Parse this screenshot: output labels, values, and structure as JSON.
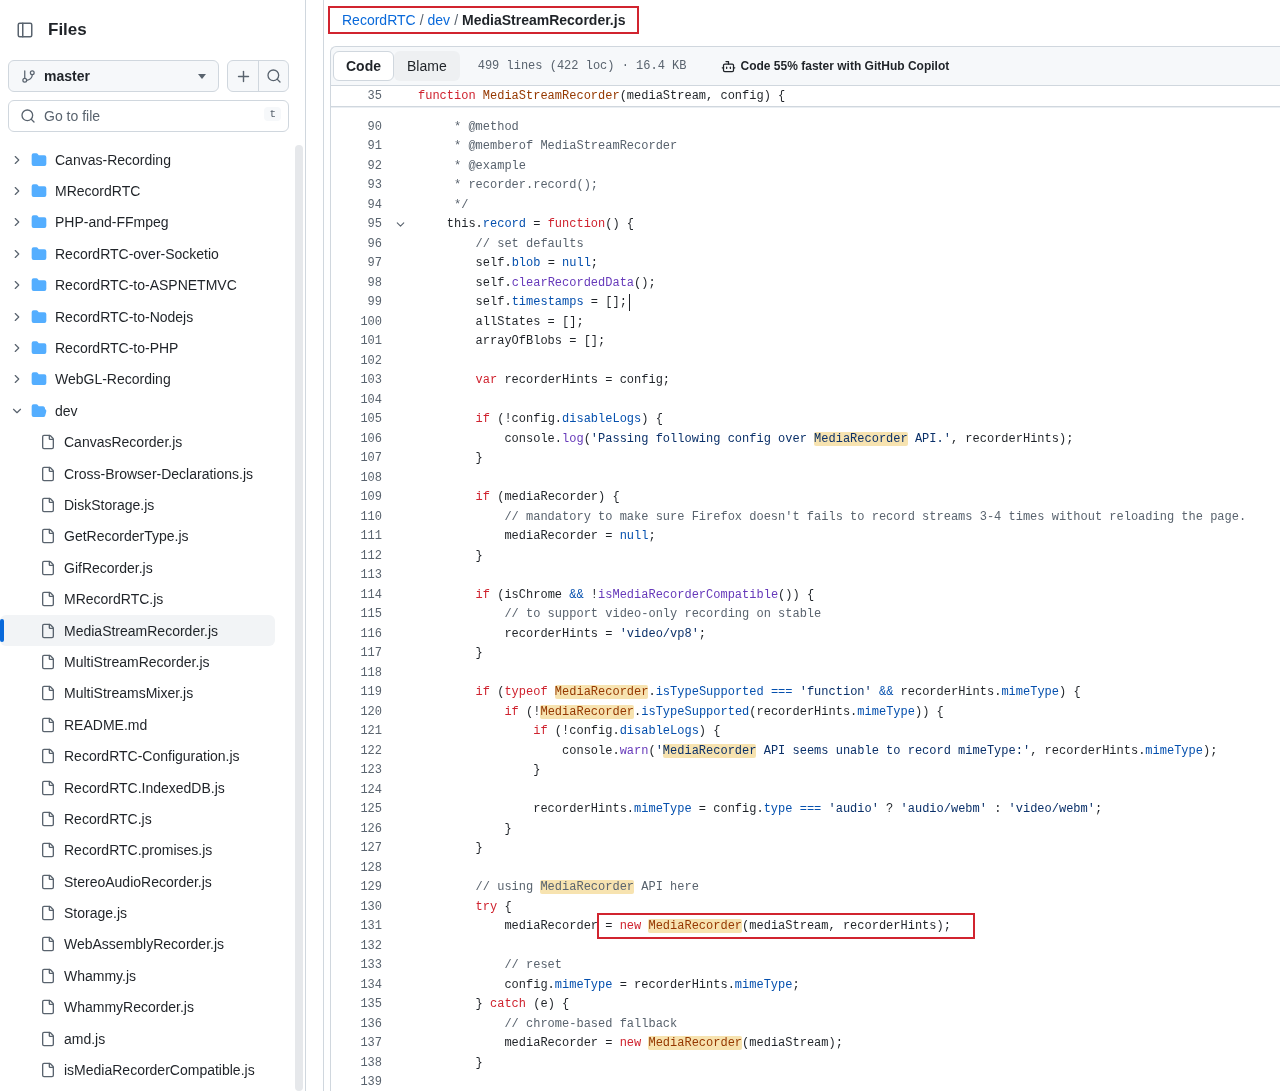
{
  "sidebar": {
    "title": "Files",
    "branch": "master",
    "search": {
      "placeholder": "Go to file",
      "shortcut": "t"
    },
    "tree": [
      {
        "kind": "folder",
        "name": "Canvas-Recording",
        "expanded": false,
        "selected": false
      },
      {
        "kind": "folder",
        "name": "MRecordRTC",
        "expanded": false,
        "selected": false
      },
      {
        "kind": "folder",
        "name": "PHP-and-FFmpeg",
        "expanded": false,
        "selected": false
      },
      {
        "kind": "folder",
        "name": "RecordRTC-over-Socketio",
        "expanded": false,
        "selected": false
      },
      {
        "kind": "folder",
        "name": "RecordRTC-to-ASPNETMVC",
        "expanded": false,
        "selected": false
      },
      {
        "kind": "folder",
        "name": "RecordRTC-to-Nodejs",
        "expanded": false,
        "selected": false
      },
      {
        "kind": "folder",
        "name": "RecordRTC-to-PHP",
        "expanded": false,
        "selected": false
      },
      {
        "kind": "folder",
        "name": "WebGL-Recording",
        "expanded": false,
        "selected": false
      },
      {
        "kind": "folder",
        "name": "dev",
        "expanded": true,
        "selected": false,
        "children": [
          {
            "kind": "file",
            "name": "CanvasRecorder.js",
            "selected": false
          },
          {
            "kind": "file",
            "name": "Cross-Browser-Declarations.js",
            "selected": false
          },
          {
            "kind": "file",
            "name": "DiskStorage.js",
            "selected": false
          },
          {
            "kind": "file",
            "name": "GetRecorderType.js",
            "selected": false
          },
          {
            "kind": "file",
            "name": "GifRecorder.js",
            "selected": false
          },
          {
            "kind": "file",
            "name": "MRecordRTC.js",
            "selected": false
          },
          {
            "kind": "file",
            "name": "MediaStreamRecorder.js",
            "selected": true
          },
          {
            "kind": "file",
            "name": "MultiStreamRecorder.js",
            "selected": false
          },
          {
            "kind": "file",
            "name": "MultiStreamsMixer.js",
            "selected": false
          },
          {
            "kind": "file",
            "name": "README.md",
            "selected": false
          },
          {
            "kind": "file",
            "name": "RecordRTC-Configuration.js",
            "selected": false
          },
          {
            "kind": "file",
            "name": "RecordRTC.IndexedDB.js",
            "selected": false
          },
          {
            "kind": "file",
            "name": "RecordRTC.js",
            "selected": false
          },
          {
            "kind": "file",
            "name": "RecordRTC.promises.js",
            "selected": false
          },
          {
            "kind": "file",
            "name": "StereoAudioRecorder.js",
            "selected": false
          },
          {
            "kind": "file",
            "name": "Storage.js",
            "selected": false
          },
          {
            "kind": "file",
            "name": "WebAssemblyRecorder.js",
            "selected": false
          },
          {
            "kind": "file",
            "name": "Whammy.js",
            "selected": false
          },
          {
            "kind": "file",
            "name": "WhammyRecorder.js",
            "selected": false
          },
          {
            "kind": "file",
            "name": "amd.js",
            "selected": false
          },
          {
            "kind": "file",
            "name": "isMediaRecorderCompatible.js",
            "selected": false
          }
        ]
      }
    ]
  },
  "breadcrumb": {
    "annotated": true,
    "parts": [
      {
        "kind": "link",
        "text": "RecordRTC"
      },
      {
        "kind": "separator",
        "text": "/"
      },
      {
        "kind": "link",
        "text": "dev"
      },
      {
        "kind": "separator",
        "text": "/"
      },
      {
        "kind": "current",
        "text": "MediaStreamRecorder.js"
      }
    ]
  },
  "toolbar": {
    "tabs": [
      {
        "label": "Code",
        "selected": true
      },
      {
        "label": "Blame",
        "selected": false
      }
    ],
    "info": "499 lines (422 loc) · 16.4 KB",
    "copilot": "Code 55% faster with GitHub Copilot"
  },
  "code": {
    "sticky": {
      "n": "35",
      "t": [
        {
          "kind": "keyword",
          "s": "function "
        },
        {
          "kind": "entity",
          "s": "MediaStreamRecorder"
        },
        {
          "kind": "plain",
          "s": "(mediaStream, config) {"
        }
      ]
    },
    "lines": [
      {
        "n": "90",
        "t": [
          {
            "kind": "comment",
            "s": "     * @method"
          }
        ]
      },
      {
        "n": "91",
        "t": [
          {
            "kind": "comment",
            "s": "     * @memberof MediaStreamRecorder"
          }
        ]
      },
      {
        "n": "92",
        "t": [
          {
            "kind": "comment",
            "s": "     * @example"
          }
        ]
      },
      {
        "n": "93",
        "t": [
          {
            "kind": "comment",
            "s": "     * recorder.record();"
          }
        ]
      },
      {
        "n": "94",
        "t": [
          {
            "kind": "comment",
            "s": "     */"
          }
        ]
      },
      {
        "n": "95",
        "foldable": true,
        "t": [
          {
            "kind": "plain",
            "s": "    this."
          },
          {
            "kind": "property",
            "s": "record"
          },
          {
            "kind": "plain",
            "s": " = "
          },
          {
            "kind": "keyword",
            "s": "function"
          },
          {
            "kind": "plain",
            "s": "() {"
          }
        ]
      },
      {
        "n": "96",
        "t": [
          {
            "kind": "comment",
            "s": "        // set defaults"
          }
        ]
      },
      {
        "n": "97",
        "t": [
          {
            "kind": "plain",
            "s": "        self."
          },
          {
            "kind": "property",
            "s": "blob"
          },
          {
            "kind": "plain",
            "s": " = "
          },
          {
            "kind": "property",
            "s": "null"
          },
          {
            "kind": "plain",
            "s": ";"
          }
        ]
      },
      {
        "n": "98",
        "t": [
          {
            "kind": "plain",
            "s": "        self."
          },
          {
            "kind": "method",
            "s": "clearRecordedData"
          },
          {
            "kind": "plain",
            "s": "();"
          }
        ]
      },
      {
        "n": "99",
        "cursor": true,
        "t": [
          {
            "kind": "plain",
            "s": "        self."
          },
          {
            "kind": "property",
            "s": "timestamps"
          },
          {
            "kind": "plain",
            "s": " = [];"
          }
        ]
      },
      {
        "n": "100",
        "t": [
          {
            "kind": "plain",
            "s": "        allStates = [];"
          }
        ]
      },
      {
        "n": "101",
        "t": [
          {
            "kind": "plain",
            "s": "        arrayOfBlobs = [];"
          }
        ]
      },
      {
        "n": "102"
      },
      {
        "n": "103",
        "t": [
          {
            "kind": "keyword",
            "s": "        var"
          },
          {
            "kind": "plain",
            "s": " recorderHints = config;"
          }
        ]
      },
      {
        "n": "104"
      },
      {
        "n": "105",
        "t": [
          {
            "kind": "keyword",
            "s": "        if"
          },
          {
            "kind": "plain",
            "s": " (!config."
          },
          {
            "kind": "property",
            "s": "disableLogs"
          },
          {
            "kind": "plain",
            "s": ") {"
          }
        ]
      },
      {
        "n": "106",
        "t": [
          {
            "kind": "plain",
            "s": "            console."
          },
          {
            "kind": "method",
            "s": "log"
          },
          {
            "kind": "plain",
            "s": "("
          },
          {
            "kind": "string",
            "s": "'Passing following config over "
          },
          {
            "kind": "string",
            "s": "MediaRecorder",
            "hl": true
          },
          {
            "kind": "string",
            "s": " API.'"
          },
          {
            "kind": "plain",
            "s": ", recorderHints);"
          }
        ]
      },
      {
        "n": "107",
        "t": [
          {
            "kind": "plain",
            "s": "        }"
          }
        ]
      },
      {
        "n": "108"
      },
      {
        "n": "109",
        "t": [
          {
            "kind": "keyword",
            "s": "        if"
          },
          {
            "kind": "plain",
            "s": " (mediaRecorder) {"
          }
        ]
      },
      {
        "n": "110",
        "t": [
          {
            "kind": "comment",
            "s": "            // mandatory to make sure Firefox doesn't fails to record streams 3-4 times without reloading the page."
          }
        ]
      },
      {
        "n": "111",
        "t": [
          {
            "kind": "plain",
            "s": "            mediaRecorder = "
          },
          {
            "kind": "property",
            "s": "null"
          },
          {
            "kind": "plain",
            "s": ";"
          }
        ]
      },
      {
        "n": "112",
        "t": [
          {
            "kind": "plain",
            "s": "        }"
          }
        ]
      },
      {
        "n": "113"
      },
      {
        "n": "114",
        "t": [
          {
            "kind": "keyword",
            "s": "        if"
          },
          {
            "kind": "plain",
            "s": " (isChrome "
          },
          {
            "kind": "property",
            "s": "&&"
          },
          {
            "kind": "plain",
            "s": " !"
          },
          {
            "kind": "method",
            "s": "isMediaRecorderCompatible"
          },
          {
            "kind": "plain",
            "s": "()) {"
          }
        ]
      },
      {
        "n": "115",
        "t": [
          {
            "kind": "comment",
            "s": "            // to support video-only recording on stable"
          }
        ]
      },
      {
        "n": "116",
        "t": [
          {
            "kind": "plain",
            "s": "            recorderHints = "
          },
          {
            "kind": "string",
            "s": "'video/vp8'"
          },
          {
            "kind": "plain",
            "s": ";"
          }
        ]
      },
      {
        "n": "117",
        "t": [
          {
            "kind": "plain",
            "s": "        }"
          }
        ]
      },
      {
        "n": "118"
      },
      {
        "n": "119",
        "t": [
          {
            "kind": "keyword",
            "s": "        if"
          },
          {
            "kind": "plain",
            "s": " ("
          },
          {
            "kind": "keyword",
            "s": "typeof "
          },
          {
            "kind": "entity",
            "s": "MediaRecorder",
            "hl": true
          },
          {
            "kind": "plain",
            "s": "."
          },
          {
            "kind": "property",
            "s": "isTypeSupported"
          },
          {
            "kind": "property",
            "s": " === "
          },
          {
            "kind": "string",
            "s": "'function'"
          },
          {
            "kind": "property",
            "s": " && "
          },
          {
            "kind": "plain",
            "s": "recorderHints."
          },
          {
            "kind": "property",
            "s": "mimeType"
          },
          {
            "kind": "plain",
            "s": ") {"
          }
        ]
      },
      {
        "n": "120",
        "t": [
          {
            "kind": "keyword",
            "s": "            if"
          },
          {
            "kind": "plain",
            "s": " (!"
          },
          {
            "kind": "entity",
            "s": "MediaRecorder",
            "hl": true
          },
          {
            "kind": "plain",
            "s": "."
          },
          {
            "kind": "property",
            "s": "isTypeSupported"
          },
          {
            "kind": "plain",
            "s": "(recorderHints."
          },
          {
            "kind": "property",
            "s": "mimeType"
          },
          {
            "kind": "plain",
            "s": ")) {"
          }
        ]
      },
      {
        "n": "121",
        "t": [
          {
            "kind": "keyword",
            "s": "                if"
          },
          {
            "kind": "plain",
            "s": " (!config."
          },
          {
            "kind": "property",
            "s": "disableLogs"
          },
          {
            "kind": "plain",
            "s": ") {"
          }
        ]
      },
      {
        "n": "122",
        "t": [
          {
            "kind": "plain",
            "s": "                    console."
          },
          {
            "kind": "method",
            "s": "warn"
          },
          {
            "kind": "plain",
            "s": "("
          },
          {
            "kind": "string",
            "s": "'"
          },
          {
            "kind": "string",
            "s": "MediaRecorder",
            "hl": true
          },
          {
            "kind": "string",
            "s": " API seems unable to record mimeType:'"
          },
          {
            "kind": "plain",
            "s": ", recorderHints."
          },
          {
            "kind": "property",
            "s": "mimeType"
          },
          {
            "kind": "plain",
            "s": ");"
          }
        ]
      },
      {
        "n": "123",
        "t": [
          {
            "kind": "plain",
            "s": "                }"
          }
        ]
      },
      {
        "n": "124"
      },
      {
        "n": "125",
        "t": [
          {
            "kind": "plain",
            "s": "                recorderHints."
          },
          {
            "kind": "property",
            "s": "mimeType"
          },
          {
            "kind": "plain",
            "s": " = config."
          },
          {
            "kind": "property",
            "s": "type"
          },
          {
            "kind": "property",
            "s": " === "
          },
          {
            "kind": "string",
            "s": "'audio'"
          },
          {
            "kind": "plain",
            "s": " ? "
          },
          {
            "kind": "string",
            "s": "'audio/webm'"
          },
          {
            "kind": "plain",
            "s": " : "
          },
          {
            "kind": "string",
            "s": "'video/webm'"
          },
          {
            "kind": "plain",
            "s": ";"
          }
        ]
      },
      {
        "n": "126",
        "t": [
          {
            "kind": "plain",
            "s": "            }"
          }
        ]
      },
      {
        "n": "127",
        "t": [
          {
            "kind": "plain",
            "s": "        }"
          }
        ]
      },
      {
        "n": "128"
      },
      {
        "n": "129",
        "t": [
          {
            "kind": "comment",
            "s": "        // using "
          },
          {
            "kind": "comment",
            "s": "MediaRecorder",
            "hl": true
          },
          {
            "kind": "comment",
            "s": " API here"
          }
        ]
      },
      {
        "n": "130",
        "t": [
          {
            "kind": "keyword",
            "s": "        try"
          },
          {
            "kind": "plain",
            "s": " {"
          }
        ]
      },
      {
        "n": "131",
        "t": [
          {
            "kind": "plain",
            "s": "            mediaRecorder "
          },
          {
            "kind": "plain",
            "s": "= ",
            "box": true
          },
          {
            "kind": "keyword",
            "s": "new ",
            "box": true
          },
          {
            "kind": "entity",
            "s": "MediaRecorder",
            "hl": true,
            "box": true
          },
          {
            "kind": "plain",
            "s": "(mediaStream, recorderHints);",
            "box": true
          }
        ]
      },
      {
        "n": "132"
      },
      {
        "n": "133",
        "t": [
          {
            "kind": "comment",
            "s": "            // reset"
          }
        ]
      },
      {
        "n": "134",
        "t": [
          {
            "kind": "plain",
            "s": "            config."
          },
          {
            "kind": "property",
            "s": "mimeType"
          },
          {
            "kind": "plain",
            "s": " = recorderHints."
          },
          {
            "kind": "property",
            "s": "mimeType"
          },
          {
            "kind": "plain",
            "s": ";"
          }
        ]
      },
      {
        "n": "135",
        "t": [
          {
            "kind": "plain",
            "s": "        } "
          },
          {
            "kind": "keyword",
            "s": "catch"
          },
          {
            "kind": "plain",
            "s": " (e) {"
          }
        ]
      },
      {
        "n": "136",
        "t": [
          {
            "kind": "comment",
            "s": "            // chrome-based fallback"
          }
        ]
      },
      {
        "n": "137",
        "t": [
          {
            "kind": "plain",
            "s": "            mediaRecorder = "
          },
          {
            "kind": "keyword",
            "s": "new "
          },
          {
            "kind": "entity",
            "s": "MediaRecorder",
            "hl": true
          },
          {
            "kind": "plain",
            "s": "(mediaStream);"
          }
        ]
      },
      {
        "n": "138",
        "t": [
          {
            "kind": "plain",
            "s": "        }"
          }
        ]
      },
      {
        "n": "139"
      }
    ]
  }
}
